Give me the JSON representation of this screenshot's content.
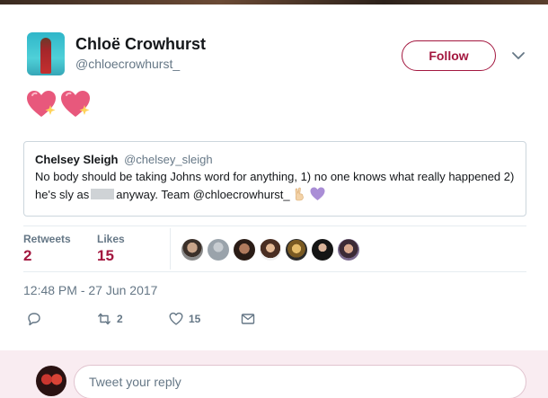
{
  "tweet": {
    "author": {
      "display_name": "Chloë Crowhurst",
      "handle": "@chloecrowhurst_"
    },
    "follow_label": "Follow",
    "text_emojis": [
      "sparkling-heart",
      "sparkling-heart"
    ],
    "quoted": {
      "display_name": "Chelsey Sleigh",
      "handle": "@chelsey_sleigh",
      "text_before_redaction": "No body should be taking Johns word for anything, 1) no one knows what really happened 2) he's sly as",
      "text_after_redaction": "anyway. Team @chloecrowhurst_",
      "trailing_emojis": [
        "victory-hand",
        "purple-heart"
      ]
    },
    "stats": {
      "retweets_label": "Retweets",
      "retweets_count": "2",
      "likes_label": "Likes",
      "likes_count": "15",
      "liker_avatar_count": 7
    },
    "timestamp": "12:48 PM - 27 Jun 2017",
    "actions": {
      "reply_count": "",
      "retweet_count": "2",
      "like_count": "15"
    }
  },
  "reply": {
    "placeholder": "Tweet your reply"
  },
  "colors": {
    "accent": "#a3173f",
    "muted_text": "#657786",
    "border": "#e6ecf0",
    "reply_bar_bg": "#f9ecf1"
  }
}
